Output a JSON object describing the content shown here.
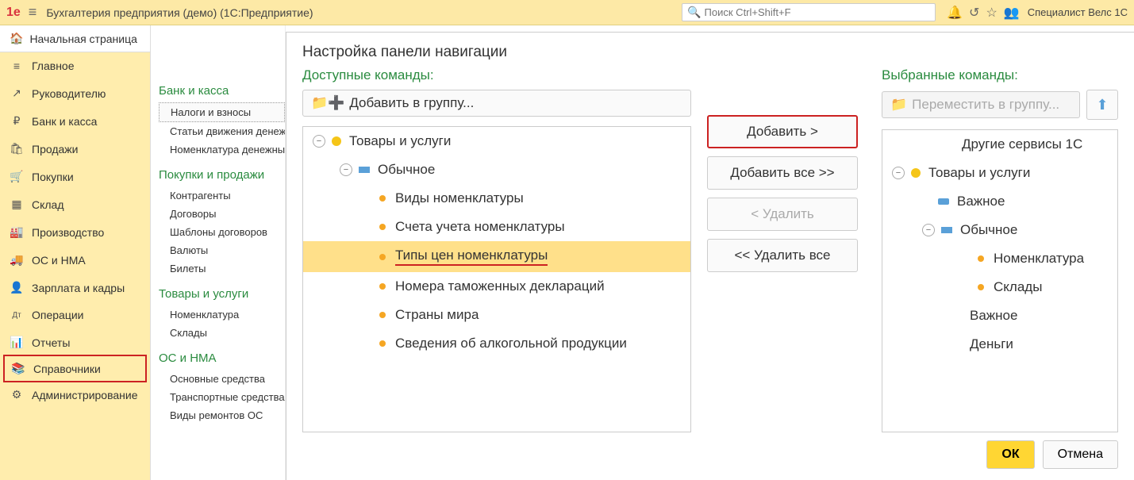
{
  "topbar": {
    "title": "Бухгалтерия предприятия (демо)  (1С:Предприятие)",
    "search_placeholder": "Поиск Ctrl+Shift+F",
    "user": "Специалист Велс 1С"
  },
  "sidebar": {
    "home": "Начальная страница",
    "items": [
      {
        "icon": "≡",
        "label": "Главное"
      },
      {
        "icon": "↗",
        "label": "Руководителю"
      },
      {
        "icon": "₽",
        "label": "Банк и касса"
      },
      {
        "icon": "🛍",
        "label": "Продажи"
      },
      {
        "icon": "🛒",
        "label": "Покупки"
      },
      {
        "icon": "▦",
        "label": "Склад"
      },
      {
        "icon": "🏭",
        "label": "Производство"
      },
      {
        "icon": "🚚",
        "label": "ОС и НМА"
      },
      {
        "icon": "👤",
        "label": "Зарплата и кадры"
      },
      {
        "icon": "Дт",
        "label": "Операции"
      },
      {
        "icon": "📊",
        "label": "Отчеты"
      },
      {
        "icon": "📚",
        "label": "Справочники"
      },
      {
        "icon": "⚙",
        "label": "Администрирование"
      }
    ]
  },
  "subpanel": {
    "groups": [
      {
        "title": "Банк и касса",
        "items": [
          "Налоги и взносы",
          "Статьи движения денежных средств",
          "Номенклатура денежных документов"
        ]
      },
      {
        "title": "Покупки и продажи",
        "items": [
          "Контрагенты",
          "Договоры",
          "Шаблоны договоров",
          "Валюты",
          "Билеты"
        ]
      },
      {
        "title": "Товары и услуги",
        "items": [
          "Номенклатура",
          "Склады"
        ]
      },
      {
        "title": "ОС и НМА",
        "items": [
          "Основные средства",
          "Транспортные средства",
          "Виды ремонтов ОС"
        ]
      }
    ]
  },
  "dialog": {
    "title": "Настройка панели навигации",
    "available_label": "Доступные команды:",
    "selected_label": "Выбранные команды:",
    "add_group_btn": "Добавить в группу...",
    "move_group_btn": "Переместить в группу...",
    "buttons": {
      "add": "Добавить >",
      "add_all": "Добавить все >>",
      "remove": "< Удалить",
      "remove_all": "<< Удалить все",
      "ok": "ОК",
      "cancel": "Отмена"
    },
    "left_tree": [
      {
        "level": 0,
        "type": "group-yellow",
        "expanded": true,
        "label": "Товары и услуги"
      },
      {
        "level": 1,
        "type": "group-blue",
        "expanded": true,
        "label": "Обычное"
      },
      {
        "level": 2,
        "type": "item",
        "label": "Виды номенклатуры"
      },
      {
        "level": 2,
        "type": "item",
        "label": "Счета учета номенклатуры"
      },
      {
        "level": 2,
        "type": "item",
        "label": "Типы цен номенклатуры",
        "selected": true
      },
      {
        "level": 2,
        "type": "item",
        "label": "Номера таможенных деклараций"
      },
      {
        "level": 2,
        "type": "item",
        "label": "Страны мира"
      },
      {
        "level": 2,
        "type": "item",
        "label": "Сведения об алкогольной продукции"
      }
    ],
    "right_tree": [
      {
        "indent": "l0",
        "type": "plain",
        "label": "Другие сервисы 1С"
      },
      {
        "indent": "lg0",
        "type": "group-yellow",
        "expanded": true,
        "label": "Товары и услуги"
      },
      {
        "indent": "lg1",
        "type": "blue-box",
        "label": "Важное"
      },
      {
        "indent": "lg2",
        "type": "group-blue",
        "expanded": true,
        "label": "Обычное"
      },
      {
        "indent": "lg3",
        "type": "item",
        "label": "Номенклатура"
      },
      {
        "indent": "lg3",
        "type": "item",
        "label": "Склады"
      },
      {
        "indent": "lg4",
        "type": "plain",
        "label": "Важное"
      },
      {
        "indent": "lg4",
        "type": "plain",
        "label": "Деньги"
      }
    ]
  }
}
